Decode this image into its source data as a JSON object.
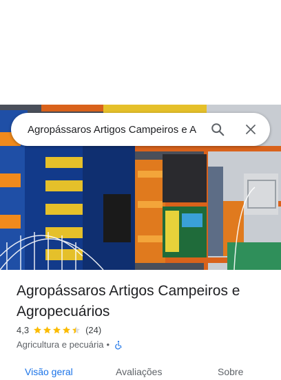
{
  "search": {
    "query": "Agropássaros Artigos Campeiros e A",
    "search_icon": "search-icon",
    "close_icon": "close-icon"
  },
  "photo": {
    "description_icon": "store-photo"
  },
  "place": {
    "name": "Agropássaros Artigos Campeiros e Agropecuários",
    "rating": "4,3",
    "stars": 4.3,
    "reviews_count": "(24)",
    "category": "Agricultura e pecuária",
    "separator": "•",
    "accessibility_icon": "wheelchair-icon"
  },
  "tabs": {
    "overview": "Visão geral",
    "reviews": "Avaliações",
    "about": "Sobre"
  },
  "colors": {
    "accent": "#1a73e8",
    "star": "#fbbc04",
    "text": "#202124",
    "secondary": "#5f6368"
  }
}
